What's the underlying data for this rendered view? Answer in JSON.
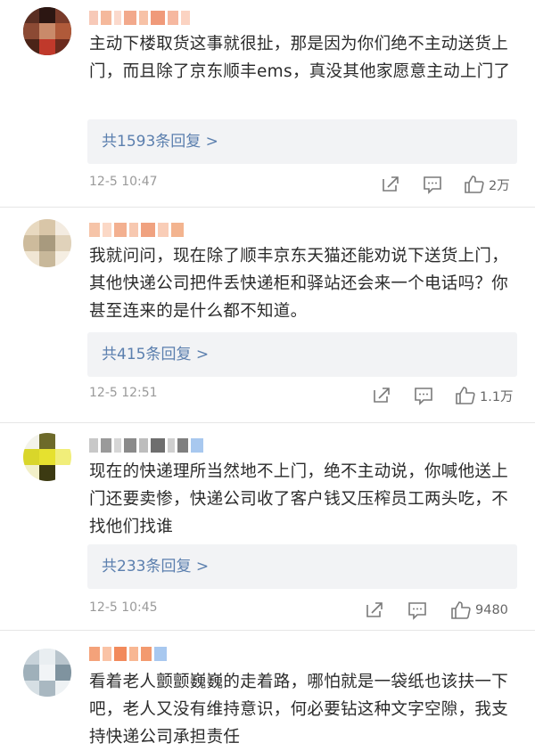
{
  "comments": [
    {
      "text": "主动下楼取货这事就很扯，那是因为你们绝不主动送货上门，而且除了京东顺丰ems，真没其他家愿意主动上门了",
      "replies": "共1593条回复 >",
      "time": "12-5 10:47",
      "likes": "2万"
    },
    {
      "text": "我就问问，现在除了顺丰京东天猫还能劝说下送货上门，其他快递公司把件丢快递柜和驿站还会来一个电话吗？你甚至连来的是什么都不知道。",
      "replies": "共415条回复 >",
      "time": "12-5 12:51",
      "likes": "1.1万"
    },
    {
      "text": "现在的快递理所当然地不上门，绝不主动说，你喊他送上门还要卖惨，快递公司收了客户钱又压榨员工两头吃，不找他们找谁",
      "replies": "共233条回复 >",
      "time": "12-5 10:45",
      "likes": "9480"
    },
    {
      "text": "看着老人颤颤巍巍的走着路，哪怕就是一袋纸也该扶一下吧，老人又没有维持意识，何必要钻这种文字空隙，我支持快递公司承担责任"
    }
  ],
  "icons": {
    "repost": "share-icon",
    "comment": "comment-icon",
    "like": "thumbs-up-icon"
  },
  "colors": {
    "reply_link": "#5b7fae",
    "reply_bg": "#f2f3f5",
    "meta_text": "#9a9a9a"
  }
}
